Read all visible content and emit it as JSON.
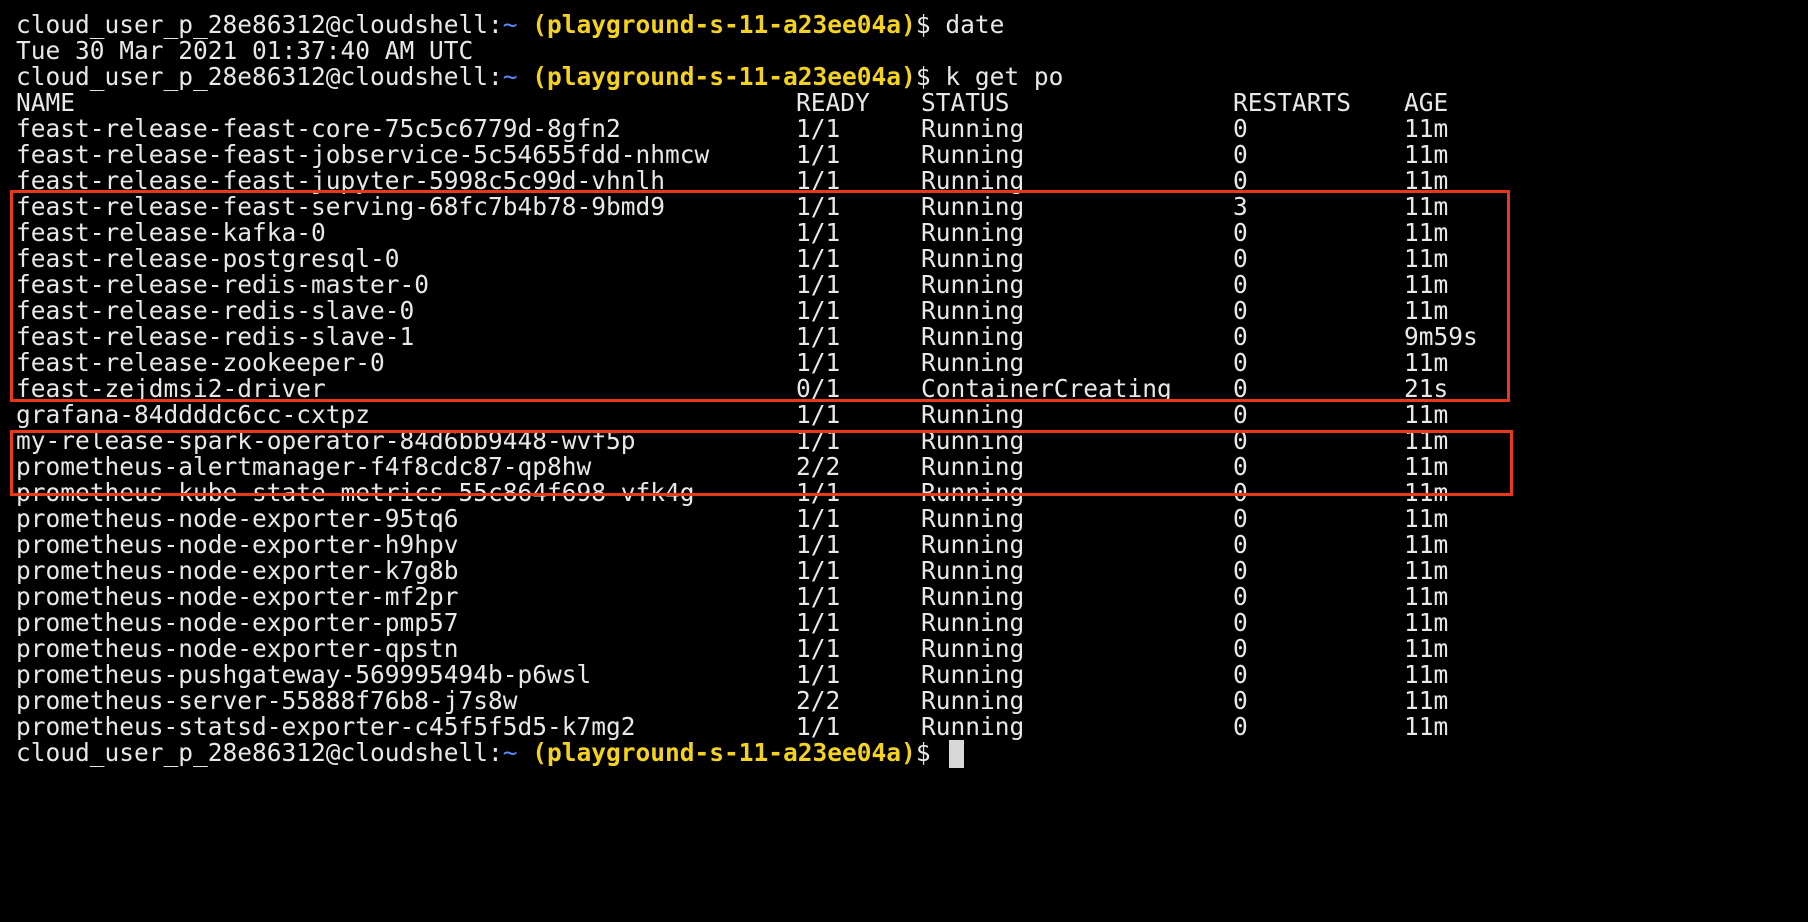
{
  "terminal": {
    "prompt": {
      "host": "cloud_user_p_28e86312@cloudshell:",
      "path": "~",
      "project": "(playground-s-11-a23ee04a)",
      "symbol": "$"
    },
    "commands": [
      {
        "text": "date"
      },
      {
        "text": "k get po"
      }
    ],
    "date_output": "Tue 30 Mar 2021 01:37:40 AM UTC",
    "table": {
      "headers": {
        "name": "NAME",
        "ready": "READY",
        "status": "STATUS",
        "restarts": "RESTARTS",
        "age": "AGE"
      },
      "rows": [
        {
          "name": "feast-release-feast-core-75c5c6779d-8gfn2",
          "ready": "1/1",
          "status": "Running",
          "restarts": "0",
          "age": "11m"
        },
        {
          "name": "feast-release-feast-jobservice-5c54655fdd-nhmcw",
          "ready": "1/1",
          "status": "Running",
          "restarts": "0",
          "age": "11m"
        },
        {
          "name": "feast-release-feast-jupyter-5998c5c99d-vhnlh",
          "ready": "1/1",
          "status": "Running",
          "restarts": "0",
          "age": "11m"
        },
        {
          "name": "feast-release-feast-serving-68fc7b4b78-9bmd9",
          "ready": "1/1",
          "status": "Running",
          "restarts": "3",
          "age": "11m"
        },
        {
          "name": "feast-release-kafka-0",
          "ready": "1/1",
          "status": "Running",
          "restarts": "0",
          "age": "11m"
        },
        {
          "name": "feast-release-postgresql-0",
          "ready": "1/1",
          "status": "Running",
          "restarts": "0",
          "age": "11m"
        },
        {
          "name": "feast-release-redis-master-0",
          "ready": "1/1",
          "status": "Running",
          "restarts": "0",
          "age": "11m"
        },
        {
          "name": "feast-release-redis-slave-0",
          "ready": "1/1",
          "status": "Running",
          "restarts": "0",
          "age": "11m"
        },
        {
          "name": "feast-release-redis-slave-1",
          "ready": "1/1",
          "status": "Running",
          "restarts": "0",
          "age": "9m59s"
        },
        {
          "name": "feast-release-zookeeper-0",
          "ready": "1/1",
          "status": "Running",
          "restarts": "0",
          "age": "11m"
        },
        {
          "name": "feast-zejdmsi2-driver",
          "ready": "0/1",
          "status": "ContainerCreating",
          "restarts": "0",
          "age": "21s"
        },
        {
          "name": "grafana-84ddddc6cc-cxtpz",
          "ready": "1/1",
          "status": "Running",
          "restarts": "0",
          "age": "11m"
        },
        {
          "name": "my-release-spark-operator-84d6bb9448-wvf5p",
          "ready": "1/1",
          "status": "Running",
          "restarts": "0",
          "age": "11m"
        },
        {
          "name": "prometheus-alertmanager-f4f8cdc87-qp8hw",
          "ready": "2/2",
          "status": "Running",
          "restarts": "0",
          "age": "11m"
        },
        {
          "name": "prometheus-kube-state-metrics-55c864f698-vfk4g",
          "ready": "1/1",
          "status": "Running",
          "restarts": "0",
          "age": "11m"
        },
        {
          "name": "prometheus-node-exporter-95tq6",
          "ready": "1/1",
          "status": "Running",
          "restarts": "0",
          "age": "11m"
        },
        {
          "name": "prometheus-node-exporter-h9hpv",
          "ready": "1/1",
          "status": "Running",
          "restarts": "0",
          "age": "11m"
        },
        {
          "name": "prometheus-node-exporter-k7g8b",
          "ready": "1/1",
          "status": "Running",
          "restarts": "0",
          "age": "11m"
        },
        {
          "name": "prometheus-node-exporter-mf2pr",
          "ready": "1/1",
          "status": "Running",
          "restarts": "0",
          "age": "11m"
        },
        {
          "name": "prometheus-node-exporter-pmp57",
          "ready": "1/1",
          "status": "Running",
          "restarts": "0",
          "age": "11m"
        },
        {
          "name": "prometheus-node-exporter-qpstn",
          "ready": "1/1",
          "status": "Running",
          "restarts": "0",
          "age": "11m"
        },
        {
          "name": "prometheus-pushgateway-569995494b-p6wsl",
          "ready": "1/1",
          "status": "Running",
          "restarts": "0",
          "age": "11m"
        },
        {
          "name": "prometheus-server-55888f76b8-j7s8w",
          "ready": "2/2",
          "status": "Running",
          "restarts": "0",
          "age": "11m"
        },
        {
          "name": "prometheus-statsd-exporter-c45f5f5d5-k7mg2",
          "ready": "1/1",
          "status": "Running",
          "restarts": "0",
          "age": "11m"
        }
      ]
    },
    "colors": {
      "background": "#000000",
      "text": "#e8e8e8",
      "tilde": "#5a8cff",
      "project": "#f4d21f",
      "highlight_border": "#e8391c",
      "cursor": "#d8d8d8"
    }
  }
}
